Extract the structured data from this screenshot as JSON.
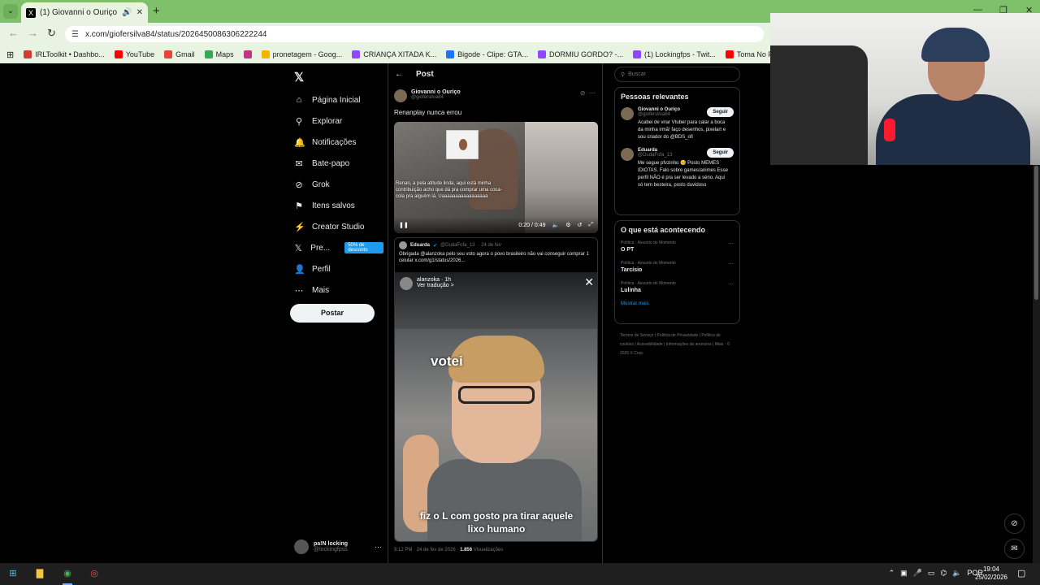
{
  "browser": {
    "tab_title": "(1) Giovanni o Ouriço no X",
    "url": "x.com/giofersilva84/status/2026450086306222244",
    "bookmarks": [
      {
        "label": "IRLToolkit • Dashbo...",
        "icon": "irltoolkit-icon",
        "color": "#d23f31"
      },
      {
        "label": "YouTube",
        "icon": "youtube-icon",
        "color": "#ff0000"
      },
      {
        "label": "Gmail",
        "icon": "gmail-icon",
        "color": "#ea4335"
      },
      {
        "label": "Maps",
        "icon": "maps-icon",
        "color": "#34a853"
      },
      {
        "label": "",
        "icon": "instagram-icon",
        "color": "#c13584"
      },
      {
        "label": "pronetagem - Goog...",
        "icon": "google-drive-icon",
        "color": "#f4b400"
      },
      {
        "label": "CRIANÇA XITADA K...",
        "icon": "twitch-icon",
        "color": "#9146ff"
      },
      {
        "label": "Bigode - Clipe: GTA...",
        "icon": "facebook-icon",
        "color": "#1877f2"
      },
      {
        "label": "DORMIU GORDO? -...",
        "icon": "twitch-icon",
        "color": "#9146ff"
      },
      {
        "label": "(1) Lockingfps - Twit...",
        "icon": "twitch-icon",
        "color": "#9146ff"
      },
      {
        "label": "Toma No Pirikito, Q...",
        "icon": "youtube-icon",
        "color": "#ff0000"
      },
      {
        "label": "Im",
        "icon": "github-icon",
        "color": "#111111"
      }
    ]
  },
  "sidebar": {
    "items": [
      {
        "label": "Página Inicial",
        "icon": "home-icon",
        "glyph": "⌂"
      },
      {
        "label": "Explorar",
        "icon": "search-icon",
        "glyph": "⚲"
      },
      {
        "label": "Notificações",
        "icon": "bell-icon",
        "glyph": "🔔"
      },
      {
        "label": "Bate-papo",
        "icon": "mail-icon",
        "glyph": "✉"
      },
      {
        "label": "Grok",
        "icon": "grok-icon",
        "glyph": "⊘"
      },
      {
        "label": "Itens salvos",
        "icon": "bookmark-icon",
        "glyph": "⚑"
      },
      {
        "label": "Creator Studio",
        "icon": "creator-studio-icon",
        "glyph": "⚡"
      },
      {
        "label": "Pre...",
        "icon": "x-premium-icon",
        "glyph": "𝕏"
      },
      {
        "label": "Perfil",
        "icon": "profile-icon",
        "glyph": "👤"
      },
      {
        "label": "Mais",
        "icon": "more-icon",
        "glyph": "⋯"
      }
    ],
    "premium_badge": "50% de desconto",
    "post_button": "Postar",
    "account": {
      "name": "pa!N locking",
      "handle": "@lockingfpss"
    }
  },
  "main": {
    "header_title": "Post",
    "author": {
      "name": "Giovanni o Ouriço",
      "handle": "@giofersilva84"
    },
    "text": "Renanplay nunca errou",
    "video": {
      "caption": "Renan, a pela atitude linda, aqui está minha contribuição acho que dá pra comprar uma coca-cola pra alguém lá. Uaaaaaaaaaaaaaaaaa",
      "time": "0:20 / 0:49"
    },
    "quote": {
      "name": "Eduarda",
      "handle": "@DudaFofa_13",
      "date": "· 24 de fev",
      "text": "Obrigada @alanzoka pelo seu voto agora o povo brasileiro não vai conseguir comprar 1 celular x.com/g1/status/2026...",
      "story_user": "alanzoka",
      "story_time": "· 1h",
      "story_translate": "Ver tradução >",
      "overlay_top": "votei",
      "overlay_bottom": "fiz o L com gosto pra tirar aquele lixo humano"
    },
    "meta_time": "9:12 PM · 24 de fev de 2026 · ",
    "meta_views": "1.856",
    "meta_views_label": " Visualizações"
  },
  "right": {
    "search_placeholder": "Buscar",
    "relevant_title": "Pessoas relevantes",
    "people": [
      {
        "name": "Giovanni o Ouriço",
        "handle": "@giofersilva84",
        "bio": "Acabei de virar Vtuber para calar a boca da minha irmã! faço desenhos, pixelart e sou criador do @BDS_ofi",
        "follow": "Seguir"
      },
      {
        "name": "Eduarda",
        "handle": "@DudaFofa_13",
        "bio": "Me segue pfvzinho 🥺 Posto MEMES IDIOTAS. Falo sobre games/animes Esse perfil NÃO é pra ser levado a sério. Aqui só tem besteira, posts duvidoso",
        "follow": "Seguir"
      }
    ],
    "trends_title": "O que está acontecendo",
    "trends": [
      {
        "context": "Política · Assunto do Momento",
        "name": "O PT"
      },
      {
        "context": "Política · Assunto do Momento",
        "name": "Tarcísio"
      },
      {
        "context": "Política · Assunto do Momento",
        "name": "Lulinha"
      }
    ],
    "show_more": "Mostrar mais",
    "footer": "Termos de Serviço | Política de Privacidade | Política de cookies | Acessibilidade | Informações de anúncios | Mais · © 2026 X Corp."
  },
  "taskbar": {
    "language": "POR",
    "time": "19:04",
    "date": "25/02/2026"
  }
}
